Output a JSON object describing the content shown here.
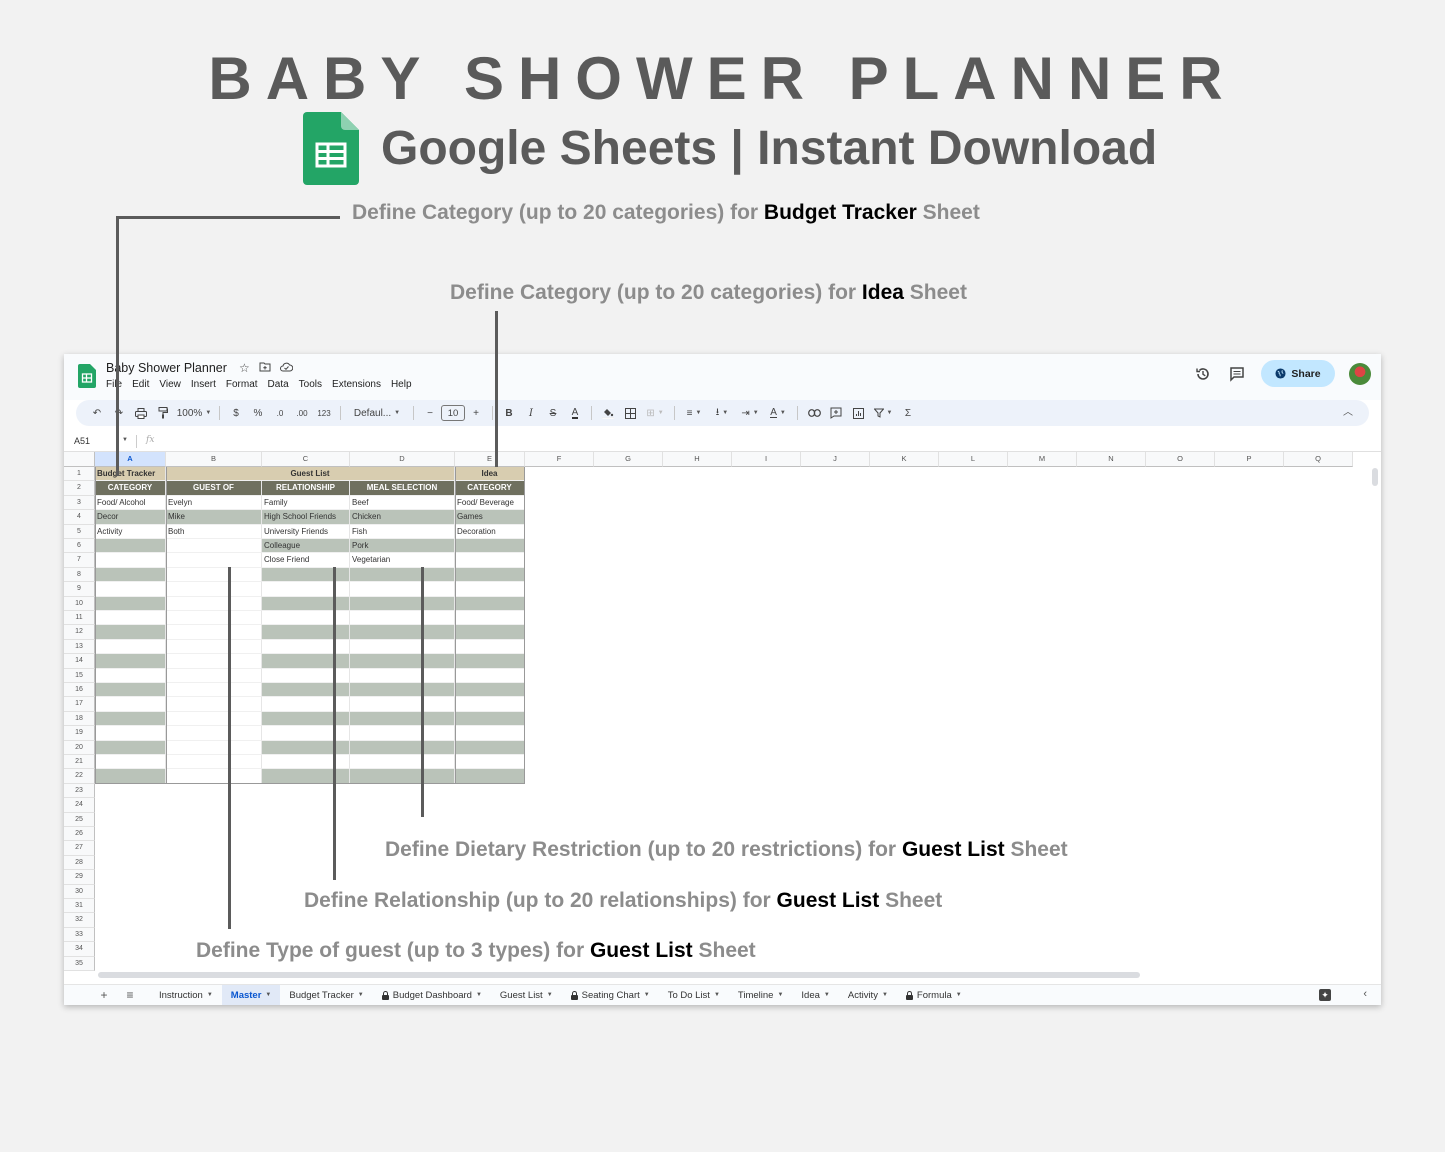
{
  "banner": {
    "title": "BABY SHOWER PLANNER",
    "subtitle": "Google Sheets | Instant Download",
    "logo_icon": "google-sheets-icon"
  },
  "annotations": [
    {
      "id": "budget-category",
      "prefix": "Define Category  (up to 20 categories) for ",
      "highlight": "Budget Tracker",
      "suffix": " Sheet"
    },
    {
      "id": "idea-category",
      "prefix": "Define Category (up to 20 categories) for ",
      "highlight": "Idea",
      "suffix": " Sheet"
    },
    {
      "id": "dietary",
      "prefix": "Define Dietary Restriction (up to 20 restrictions) for ",
      "highlight": "Guest List",
      "suffix": " Sheet"
    },
    {
      "id": "relationship",
      "prefix": "Define Relationship  (up to 20 relationships) for ",
      "highlight": "Guest List",
      "suffix": " Sheet"
    },
    {
      "id": "guest-type",
      "prefix": "Define Type of guest  (up to 3 types) for ",
      "highlight": "Guest List",
      "suffix": " Sheet"
    }
  ],
  "window": {
    "doc_title": "Baby Shower Planner",
    "menu": [
      "File",
      "Edit",
      "View",
      "Insert",
      "Format",
      "Data",
      "Tools",
      "Extensions",
      "Help"
    ],
    "share_label": "Share",
    "toolbar": {
      "zoom": "100%",
      "currency": "$",
      "percent": "%",
      "dec_decrease": ".0",
      "dec_increase": ".00",
      "number_format": "123",
      "font": "Defaul...",
      "font_size": "10",
      "minus": "−",
      "plus": "+",
      "bold": "B",
      "italic": "I"
    },
    "name_box": "A51",
    "fx_label": "fx"
  },
  "sheet": {
    "columns": [
      "A",
      "B",
      "C",
      "D",
      "E",
      "F",
      "G",
      "H",
      "I",
      "J",
      "K",
      "L",
      "M",
      "N",
      "O",
      "P",
      "Q"
    ],
    "selected_column": "A",
    "row_count": 35,
    "group_headers": {
      "A": "Budget Tracker",
      "BCD": "Guest List",
      "E": "Idea"
    },
    "column_headers": [
      "CATEGORY",
      "GUEST OF",
      "RELATIONSHIP",
      "MEAL SELECTION",
      "CATEGORY"
    ],
    "columns_data": {
      "A": [
        "Food/ Alcohol",
        "Decor",
        "Activity"
      ],
      "B": [
        "Evelyn",
        "Mike",
        "Both"
      ],
      "C": [
        "Family",
        "High School Friends",
        "University Friends",
        "Colleague",
        "Close Friend"
      ],
      "D": [
        "Beef",
        "Chicken",
        "Fish",
        "Pork",
        "Vegetarian"
      ],
      "E": [
        "Food/ Beverage",
        "Games",
        "Decoration"
      ]
    }
  },
  "sheet_tabs": [
    {
      "label": "Instruction",
      "locked": false,
      "active": false
    },
    {
      "label": "Master",
      "locked": false,
      "active": true
    },
    {
      "label": "Budget Tracker",
      "locked": false,
      "active": false
    },
    {
      "label": "Budget Dashboard",
      "locked": true,
      "active": false
    },
    {
      "label": "Guest List",
      "locked": false,
      "active": false
    },
    {
      "label": "Seating Chart",
      "locked": true,
      "active": false
    },
    {
      "label": "To Do List",
      "locked": false,
      "active": false
    },
    {
      "label": "Timeline",
      "locked": false,
      "active": false
    },
    {
      "label": "Idea",
      "locked": false,
      "active": false
    },
    {
      "label": "Activity",
      "locked": false,
      "active": false
    },
    {
      "label": "Formula",
      "locked": true,
      "active": false
    }
  ],
  "colors": {
    "tan": "#d8cdb0",
    "header_dark": "#6f705f",
    "band": "#bac3b9",
    "share_bg": "#c2e7ff",
    "active_tab": "#0b57d0"
  }
}
